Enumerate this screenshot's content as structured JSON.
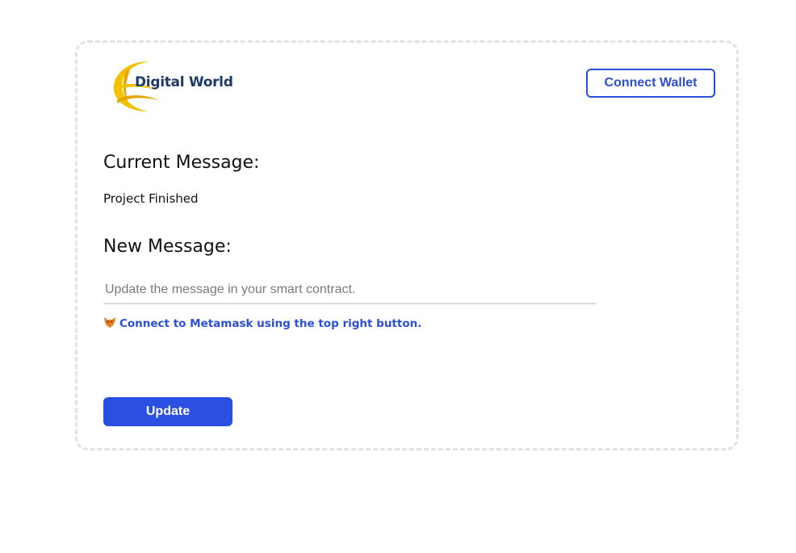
{
  "header": {
    "logo_text": "Digital World",
    "logo_icon": "globe-swoosh-logo",
    "connect_wallet_label": "Connect Wallet"
  },
  "current": {
    "heading": "Current Message:",
    "value": "Project Finished"
  },
  "new_message": {
    "heading": "New Message:",
    "placeholder": "Update the message in your smart contract.",
    "value": ""
  },
  "status": {
    "icon": "fox-icon",
    "text": "Connect to Metamask using the top right button."
  },
  "actions": {
    "update_label": "Update"
  },
  "colors": {
    "accent": "#2b4fd8",
    "logo_gold": "#f2c200",
    "logo_navy": "#1c3a6b",
    "border_dashed": "#e2e2e2"
  }
}
